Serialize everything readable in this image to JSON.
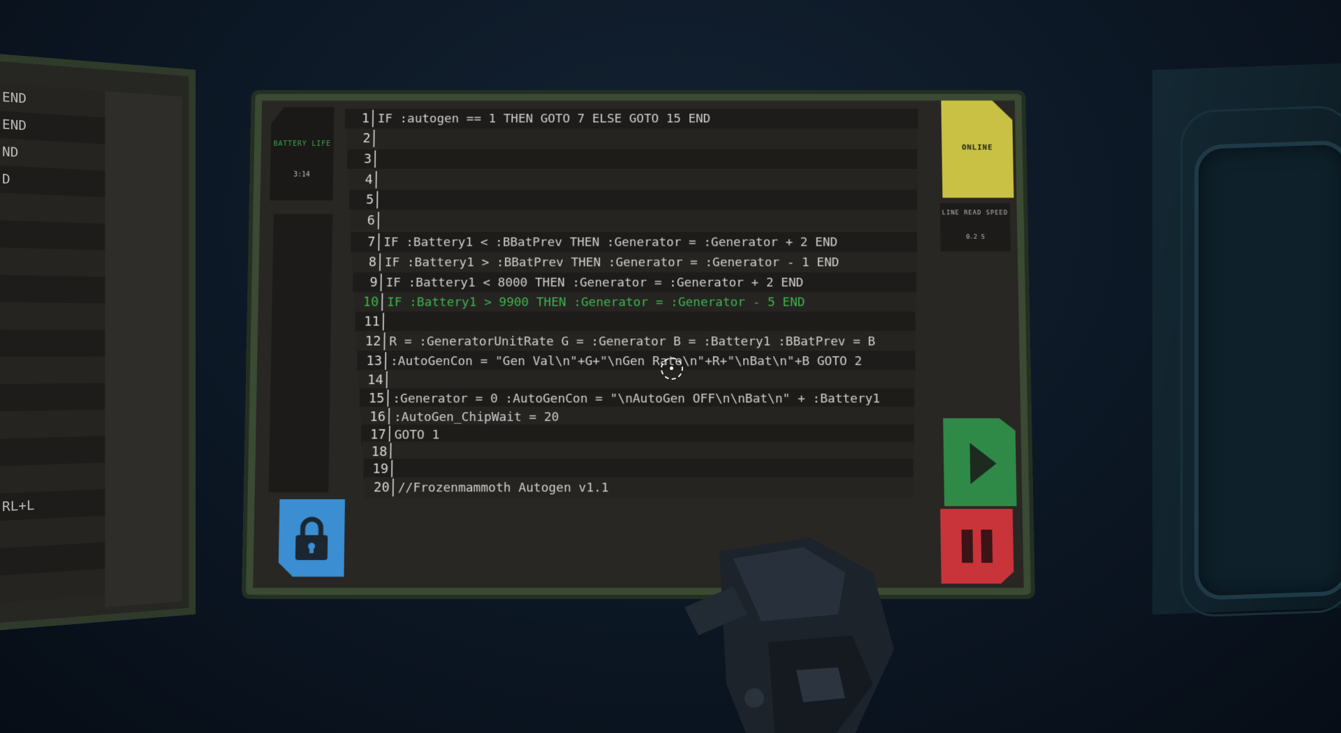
{
  "left_monitor": {
    "visible_fragments": [
      "END",
      "END",
      "ND",
      "D",
      "",
      "",
      "",
      "",
      "",
      "",
      "",
      "",
      "",
      "",
      "",
      "RL+L",
      "",
      "",
      ""
    ]
  },
  "main_monitor": {
    "battery": {
      "title": "BATTERY LIFE",
      "value": "3:14"
    },
    "status": {
      "label": "ONLINE"
    },
    "line_read_speed": {
      "title": "LINE READ SPEED",
      "value": "0.2 S"
    },
    "code_lines": [
      {
        "n": "1",
        "text": "IF :autogen == 1 THEN GOTO 7 ELSE GOTO 15 END"
      },
      {
        "n": "2",
        "text": ""
      },
      {
        "n": "3",
        "text": ""
      },
      {
        "n": "4",
        "text": ""
      },
      {
        "n": "5",
        "text": ""
      },
      {
        "n": "6",
        "text": ""
      },
      {
        "n": "7",
        "text": "IF :Battery1 < :BBatPrev THEN :Generator = :Generator + 2 END"
      },
      {
        "n": "8",
        "text": "IF :Battery1 > :BBatPrev THEN :Generator = :Generator - 1 END"
      },
      {
        "n": "9",
        "text": "IF :Battery1 < 8000 THEN :Generator = :Generator + 2 END"
      },
      {
        "n": "10",
        "text": "IF :Battery1 > 9900 THEN :Generator = :Generator - 5 END",
        "active": true
      },
      {
        "n": "11",
        "text": ""
      },
      {
        "n": "12",
        "text": "R = :GeneratorUnitRate G = :Generator B = :Battery1 :BBatPrev = B"
      },
      {
        "n": "13",
        "text": ":AutoGenCon = \"Gen Val\\n\"+G+\"\\nGen Rate\\n\"+R+\"\\nBat\\n\"+B GOTO 2"
      },
      {
        "n": "14",
        "text": ""
      },
      {
        "n": "15",
        "text": ":Generator = 0 :AutoGenCon = \"\\nAutoGen OFF\\n\\nBat\\n\" + :Battery1"
      },
      {
        "n": "16",
        "text": ":AutoGen_ChipWait = 20"
      },
      {
        "n": "17",
        "text": "GOTO 1"
      },
      {
        "n": "18",
        "text": ""
      },
      {
        "n": "19",
        "text": ""
      },
      {
        "n": "20",
        "text": "//Frozenmammoth Autogen v1.1"
      }
    ]
  },
  "colors": {
    "online": "#c9c144",
    "play": "#2f8a47",
    "pause": "#c9343a",
    "lock": "#3a8ed1",
    "active_line": "#3fb24f"
  },
  "icons": [
    "lock-icon",
    "play-icon",
    "pause-icon",
    "crosshair-icon"
  ]
}
